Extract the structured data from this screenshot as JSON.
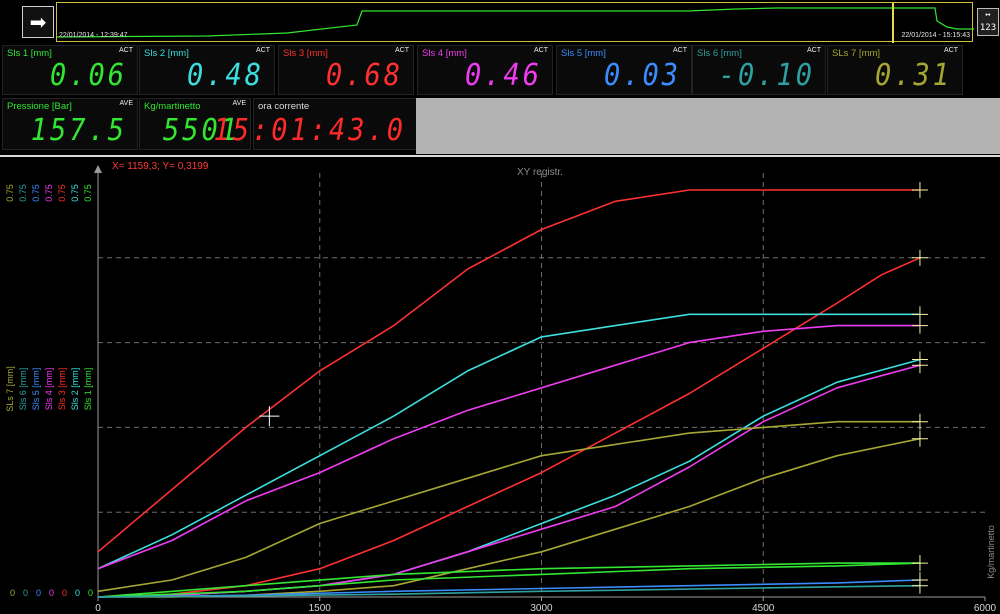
{
  "toolbar": {
    "nav_icon": "arrow-right-icon",
    "nav_glyph": "➡",
    "scale_icon": "autoscale-123-icon",
    "scale_glyph": "↔ 123"
  },
  "overview": {
    "start_time": "22/01/2014 - 12:39:47",
    "end_time": "22/01/2014 - 15:15:43"
  },
  "gauges": [
    {
      "label": "Sls 1 [mm]",
      "mode": "ACT",
      "value": "0.06",
      "color": "#32e632"
    },
    {
      "label": "Sls 2 [mm]",
      "mode": "ACT",
      "value": "0.48",
      "color": "#3cdede"
    },
    {
      "label": "Sls 3 [mm]",
      "mode": "ACT",
      "value": "0.68",
      "color": "#ff3030"
    },
    {
      "label": "Sls 4 [mm]",
      "mode": "ACT",
      "value": "0.46",
      "color": "#f03cf0"
    },
    {
      "label": "Sls 5 [mm]",
      "mode": "ACT",
      "value": "0.03",
      "color": "#3a8cff"
    },
    {
      "label": "Sls 6 [mm]",
      "mode": "ACT",
      "value": "-0.10",
      "color": "#2fa0a0"
    },
    {
      "label": "SLs 7 [mm]",
      "mode": "ACT",
      "value": "0.31",
      "color": "#a6a632"
    },
    {
      "label": "Pressione [Bar]",
      "mode": "AVE",
      "value": "157.5",
      "color": "#32e632"
    },
    {
      "label": "Kg/martinetto",
      "mode": "AVE",
      "value": "5501",
      "color": "#32e632"
    },
    {
      "label": "ora corrente",
      "mode": "",
      "value": "15:01:43.0",
      "color": "#ff2a2a"
    }
  ],
  "chart": {
    "title": "XY registr.",
    "cursor_readout": "X= 1159,3; Y= 0,3199",
    "right_axis_label": "Kg/martinetto",
    "x_ticks": [
      "0",
      "1500",
      "3000",
      "4500",
      "6000"
    ],
    "y_axis_labels": [
      "SLs 7 [mm]",
      "Sls 6 [mm]",
      "Sls 5 [mm]",
      "Sls 4 [mm]",
      "Sls 3 [mm]",
      "Sls 2 [mm]",
      "Sls 1 [mm]"
    ],
    "y_top_value": "0.75",
    "y_bottom_value": "0",
    "colors": {
      "grid": "#6e6e6e",
      "sls1": "#32e632",
      "sls2": "#3cdede",
      "sls3": "#ff3030",
      "sls4": "#f03cf0",
      "sls5": "#3a8cff",
      "sls6": "#2fa0a0",
      "sls7": "#a6a632"
    }
  },
  "chart_data": {
    "type": "line",
    "title": "XY registr.",
    "xlabel": "",
    "ylabel": "",
    "xlim": [
      0,
      6000
    ],
    "ylim": [
      0,
      0.75
    ],
    "series": [
      {
        "name": "Sls 3 [mm]",
        "color": "#ff3030",
        "x": [
          0,
          500,
          1000,
          1500,
          2000,
          2500,
          3000,
          3500,
          4000,
          4200,
          4500,
          5000,
          5500,
          5560
        ],
        "y": [
          0.08,
          0.19,
          0.3,
          0.4,
          0.48,
          0.58,
          0.65,
          0.7,
          0.72,
          0.72,
          0.72,
          0.72,
          0.72,
          0.72
        ]
      },
      {
        "name": "Sls 3 [mm] (return)",
        "color": "#ff3030",
        "x": [
          5560,
          5300,
          5000,
          4500,
          4000,
          3500,
          3000,
          2500,
          2000,
          1500,
          1000,
          500,
          0
        ],
        "y": [
          0.6,
          0.57,
          0.52,
          0.44,
          0.36,
          0.29,
          0.22,
          0.16,
          0.1,
          0.05,
          0.02,
          0.005,
          0.0
        ]
      },
      {
        "name": "Sls 2 [mm]",
        "color": "#3cdede",
        "x": [
          0,
          500,
          1000,
          1500,
          2000,
          2500,
          3000,
          3500,
          4000,
          4500,
          5000,
          5560
        ],
        "y": [
          0.05,
          0.11,
          0.18,
          0.25,
          0.32,
          0.4,
          0.46,
          0.48,
          0.5,
          0.5,
          0.5,
          0.5
        ]
      },
      {
        "name": "Sls 2 [mm] (return)",
        "color": "#3cdede",
        "x": [
          5560,
          5000,
          4500,
          4000,
          3500,
          3000,
          2500,
          2000,
          1500,
          1000,
          500,
          0
        ],
        "y": [
          0.42,
          0.38,
          0.32,
          0.24,
          0.18,
          0.13,
          0.08,
          0.04,
          0.02,
          0.01,
          0.003,
          0.0
        ]
      },
      {
        "name": "Sls 4 [mm]",
        "color": "#f03cf0",
        "x": [
          0,
          500,
          1000,
          1500,
          2000,
          2500,
          3000,
          3500,
          4000,
          4500,
          5000,
          5560
        ],
        "y": [
          0.05,
          0.1,
          0.17,
          0.22,
          0.28,
          0.33,
          0.37,
          0.41,
          0.45,
          0.47,
          0.48,
          0.48
        ]
      },
      {
        "name": "Sls 4 [mm] (return)",
        "color": "#f03cf0",
        "x": [
          5560,
          5000,
          4500,
          4000,
          3500,
          3000,
          2500,
          2000,
          1500,
          1000,
          500,
          0
        ],
        "y": [
          0.41,
          0.37,
          0.31,
          0.23,
          0.16,
          0.12,
          0.08,
          0.04,
          0.02,
          0.01,
          0.003,
          0.0
        ]
      },
      {
        "name": "SLs 7 [mm]",
        "color": "#a6a632",
        "x": [
          0,
          500,
          1000,
          1500,
          2000,
          2500,
          3000,
          3500,
          4000,
          4500,
          5000,
          5560
        ],
        "y": [
          0.01,
          0.03,
          0.07,
          0.13,
          0.17,
          0.21,
          0.25,
          0.27,
          0.29,
          0.3,
          0.31,
          0.31
        ]
      },
      {
        "name": "SLs 7 [mm] (return)",
        "color": "#a6a632",
        "x": [
          5560,
          5000,
          4500,
          4000,
          3500,
          3000,
          2500,
          2000,
          1500,
          1000,
          500,
          0
        ],
        "y": [
          0.28,
          0.25,
          0.21,
          0.16,
          0.12,
          0.08,
          0.05,
          0.02,
          0.01,
          0.003,
          0.0,
          0.0
        ]
      },
      {
        "name": "Sls 1 [mm]",
        "color": "#32e632",
        "x": [
          0,
          1000,
          2000,
          3000,
          4000,
          5000,
          5560,
          5000,
          4000,
          3000,
          2000,
          1000,
          0
        ],
        "y": [
          0.0,
          0.01,
          0.03,
          0.04,
          0.05,
          0.055,
          0.06,
          0.06,
          0.055,
          0.05,
          0.04,
          0.02,
          0.0
        ]
      },
      {
        "name": "Sls 5 [mm]",
        "color": "#3a8cff",
        "x": [
          0,
          1000,
          2000,
          3000,
          4000,
          5000,
          5560
        ],
        "y": [
          0.0,
          0.003,
          0.01,
          0.015,
          0.02,
          0.025,
          0.03
        ]
      },
      {
        "name": "Sls 6 [mm]",
        "color": "#2fa0a0",
        "x": [
          0,
          1000,
          2000,
          3000,
          4000,
          5000,
          5560
        ],
        "y": [
          0.0,
          0.002,
          0.005,
          0.01,
          0.014,
          0.018,
          0.02
        ]
      }
    ],
    "cursor": {
      "x": 1159.3,
      "y": 0.3199
    }
  }
}
